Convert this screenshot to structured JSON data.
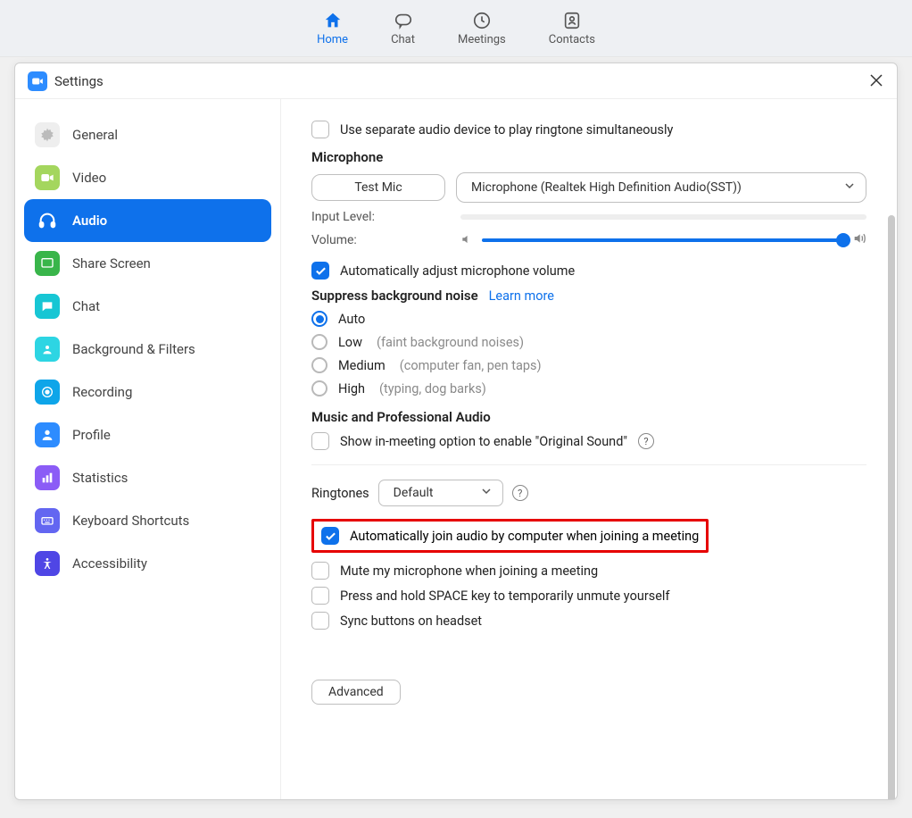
{
  "topnav": {
    "home": "Home",
    "chat": "Chat",
    "meetings": "Meetings",
    "contacts": "Contacts"
  },
  "window": {
    "title": "Settings"
  },
  "sidebar": {
    "items": [
      {
        "label": "General"
      },
      {
        "label": "Video"
      },
      {
        "label": "Audio"
      },
      {
        "label": "Share Screen"
      },
      {
        "label": "Chat"
      },
      {
        "label": "Background & Filters"
      },
      {
        "label": "Recording"
      },
      {
        "label": "Profile"
      },
      {
        "label": "Statistics"
      },
      {
        "label": "Keyboard Shortcuts"
      },
      {
        "label": "Accessibility"
      }
    ]
  },
  "audio": {
    "separate_device": "Use separate audio device to play ringtone simultaneously",
    "mic_heading": "Microphone",
    "test_mic": "Test Mic",
    "mic_device": "Microphone (Realtek High Definition Audio(SST))",
    "input_level": "Input Level:",
    "volume": "Volume:",
    "auto_adjust": "Automatically adjust microphone volume",
    "suppress_heading": "Suppress background noise",
    "learn_more": "Learn more",
    "suppress": {
      "auto": "Auto",
      "low": "Low",
      "low_hint": "(faint background noises)",
      "medium": "Medium",
      "medium_hint": "(computer fan, pen taps)",
      "high": "High",
      "high_hint": "(typing, dog barks)"
    },
    "music_heading": "Music and Professional Audio",
    "orig_sound": "Show in-meeting option to enable \"Original Sound\"",
    "ringtones_label": "Ringtones",
    "ringtone_value": "Default",
    "auto_join": "Automatically join audio by computer when joining a meeting",
    "mute_join": "Mute my microphone when joining a meeting",
    "space_unmute": "Press and hold SPACE key to temporarily unmute yourself",
    "sync_headset": "Sync buttons on headset",
    "advanced": "Advanced"
  },
  "colors": {
    "accent": "#0e71eb"
  }
}
